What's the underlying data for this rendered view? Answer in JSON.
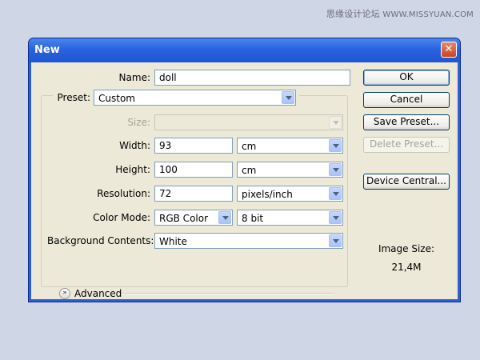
{
  "watermark": {
    "cn": "思缘设计论坛",
    "site": "WWW.MISSYUAN.COM"
  },
  "window": {
    "title": "New",
    "close_glyph": "✕"
  },
  "form": {
    "name": {
      "label": "Name:",
      "value": "doll"
    },
    "preset": {
      "label": "Preset:",
      "value": "Custom"
    },
    "size": {
      "label": "Size:",
      "value": ""
    },
    "width": {
      "label": "Width:",
      "value": "93",
      "unit": "cm"
    },
    "height": {
      "label": "Height:",
      "value": "100",
      "unit": "cm"
    },
    "resolution": {
      "label": "Resolution:",
      "value": "72",
      "unit": "pixels/inch"
    },
    "color_mode": {
      "label": "Color Mode:",
      "value": "RGB Color",
      "depth": "8 bit"
    },
    "background": {
      "label": "Background Contents:",
      "value": "White"
    },
    "advanced": {
      "label": "Advanced",
      "icon": "chevron-double-down-icon"
    }
  },
  "buttons": {
    "ok": "OK",
    "cancel": "Cancel",
    "save_preset": "Save Preset...",
    "delete_preset": "Delete Preset...",
    "device_central": "Device Central..."
  },
  "image_size": {
    "label": "Image Size:",
    "value": "21,4M"
  },
  "colors": {
    "desktop": "#cfd6e6",
    "titlebar": "#2a63de",
    "dialog": "#ece9d8",
    "close": "#c94520",
    "field_border": "#7f9db9"
  }
}
